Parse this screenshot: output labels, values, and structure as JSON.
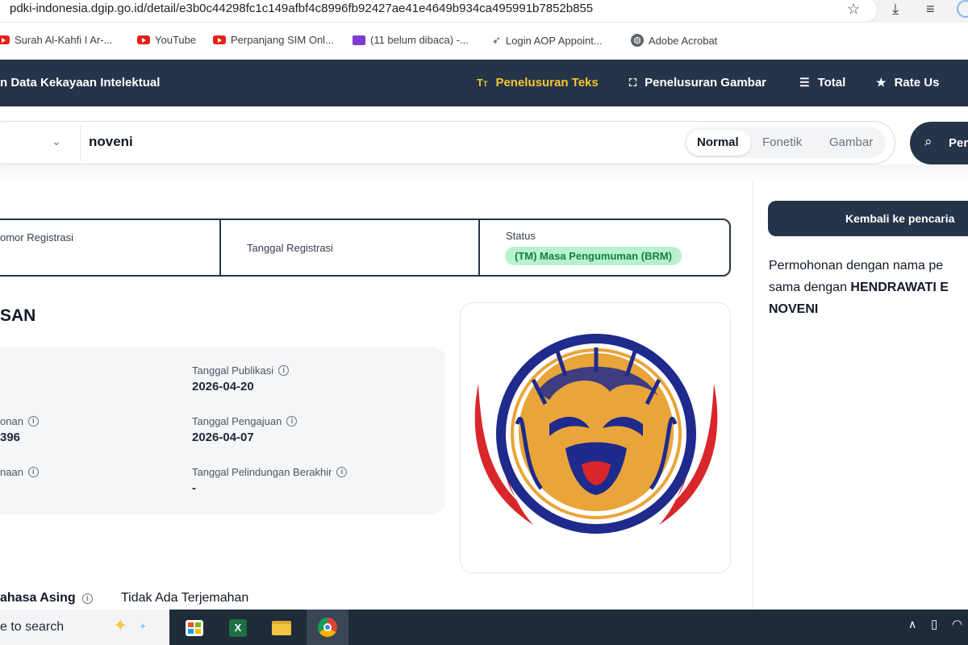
{
  "browser": {
    "url": "pdki-indonesia.dgip.go.id/detail/e3b0c44298fc1c149afbf4c8996fb92427ae41e4649b934ca495991b7852b855",
    "bookmarks": [
      {
        "label": "Surah Al-Kahfi I Ar-...",
        "icon": "youtube-icon"
      },
      {
        "label": "YouTube",
        "icon": "youtube-icon"
      },
      {
        "label": "Perpanjang SIM Onl...",
        "icon": "youtube-icon"
      },
      {
        "label": "(11 belum dibaca) -...",
        "icon": "mail-icon"
      },
      {
        "label": "Login AOP Appoint...",
        "icon": "feather-icon"
      },
      {
        "label": "Adobe Acrobat",
        "icon": "globe-icon"
      }
    ]
  },
  "header": {
    "title": "n Data Kekayaan Intelektual",
    "nav": [
      {
        "label": "Penelusuran Teks",
        "icon": "text-search-icon",
        "active": true
      },
      {
        "label": "Penelusuran Gambar",
        "icon": "image-scan-icon",
        "active": false
      },
      {
        "label": "Total",
        "icon": "list-icon",
        "active": false
      },
      {
        "label": "Rate Us",
        "icon": "star-icon",
        "active": false
      }
    ]
  },
  "search": {
    "query": "noveni",
    "modes": [
      "Normal",
      "Fonetik",
      "Gambar"
    ],
    "selected_mode": "Normal",
    "button_label": "Per"
  },
  "info_bar": {
    "reg_number_label": "omor Registrasi",
    "reg_date_label": "Tanggal Registrasi",
    "status_label": "Status",
    "status_value": "(TM) Masa Pengumuman (BRM)"
  },
  "detail": {
    "title": "SAN",
    "fields": [
      {
        "label": "Tanggal Publikasi",
        "value": "2026-04-20"
      },
      {
        "label": "onan",
        "value": "396"
      },
      {
        "label": "Tanggal Pengajuan",
        "value": "2026-04-07"
      },
      {
        "label": "naan",
        "value": ""
      },
      {
        "label": "Tanggal Pelindungan Berakhir",
        "value": "-"
      }
    ],
    "translation_label": "ahasa Asing",
    "translation_value": "Tidak Ada Terjemahan"
  },
  "right_panel": {
    "back_button": "Kembali ke pencaria",
    "notice_line1": "Permohonan dengan nama pe",
    "notice_line2_prefix": "sama dengan ",
    "notice_line2_bold": "HENDRAWATI E",
    "notice_line3_bold": "NOVENI"
  },
  "taskbar": {
    "search_text": "e to search"
  },
  "colors": {
    "header_bg": "#263449",
    "active_nav": "#f5c533",
    "status_badge_bg": "#b7f2cf",
    "status_badge_text": "#15803d",
    "logo_blue": "#1e2a8c",
    "logo_orange": "#e9a53a",
    "logo_red": "#d9262b"
  }
}
